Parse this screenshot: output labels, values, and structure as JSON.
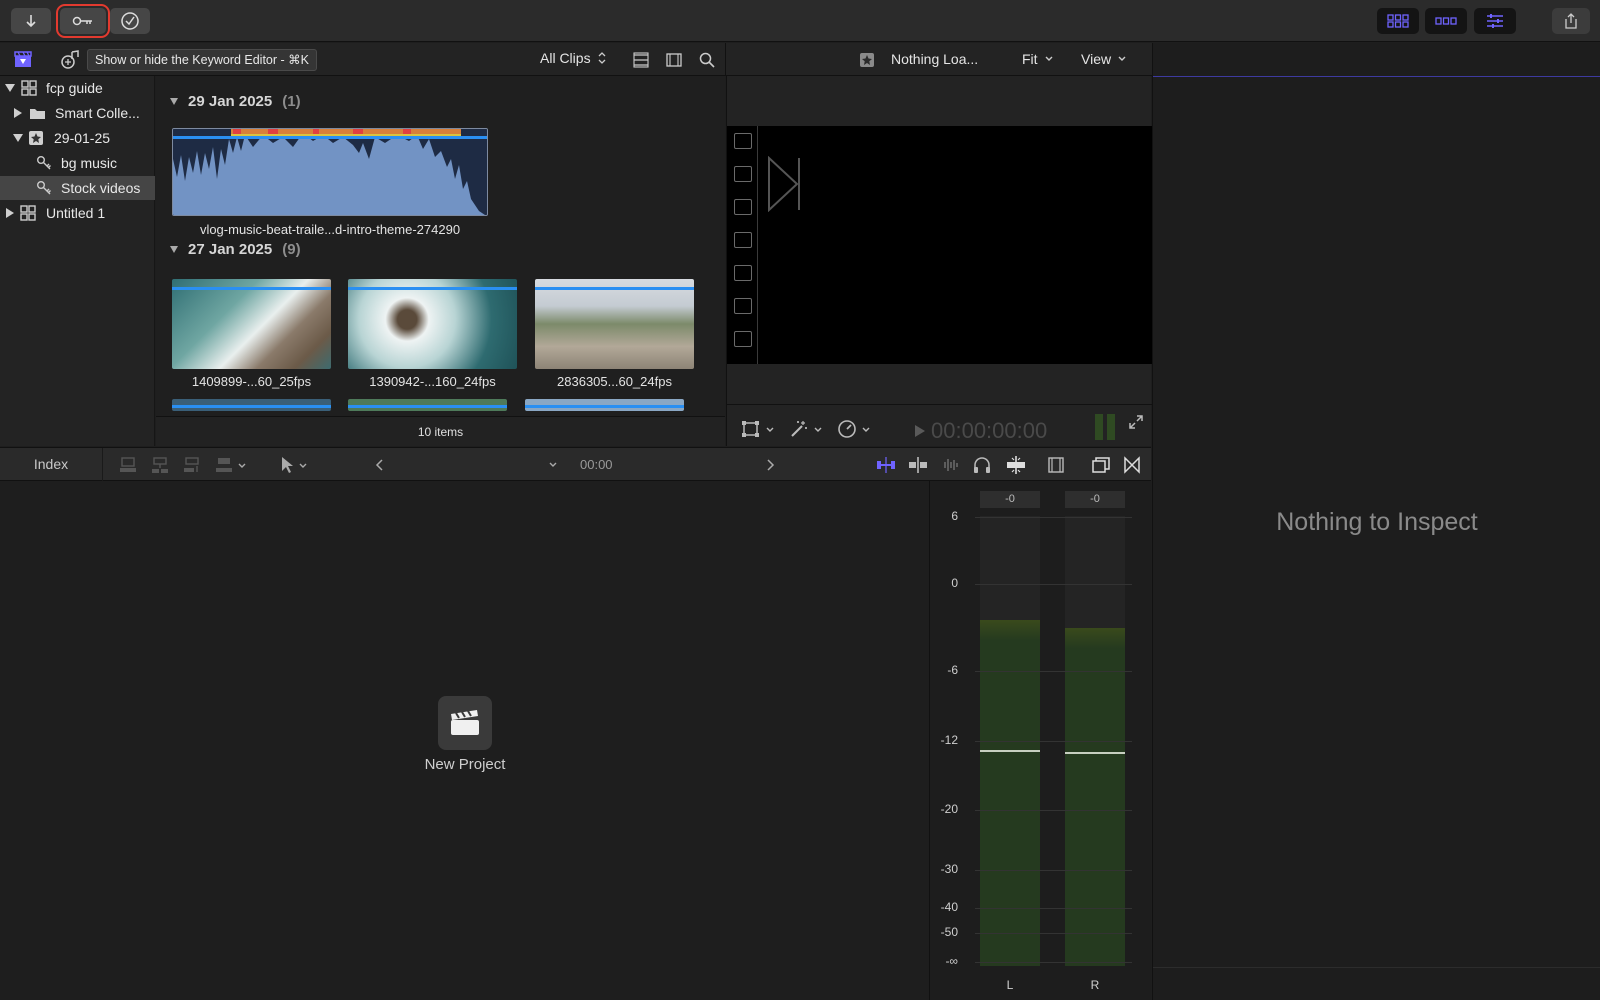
{
  "toolbar": {
    "buttons": [
      {
        "icon": "import-arrow-icon"
      },
      {
        "icon": "keyword-key-icon",
        "highlighted": true
      },
      {
        "icon": "checkmark-circle-icon"
      }
    ],
    "right_buttons": [
      {
        "icon": "browser-grid-icon"
      },
      {
        "icon": "timeline-icon"
      },
      {
        "icon": "inspector-sliders-icon"
      },
      {
        "icon": "share-icon"
      }
    ]
  },
  "tooltip": "Show or hide the Keyword Editor - ⌘K",
  "browser_header": {
    "filter": "All Clips",
    "viewer_title": "Nothing Loa...",
    "fit": "Fit",
    "view": "View"
  },
  "sidebar": {
    "items": [
      {
        "label": "fcp guide",
        "icon": "library-icon",
        "expanded": true
      },
      {
        "label": "Smart Colle...",
        "icon": "folder-icon",
        "expanded": false
      },
      {
        "label": "29-01-25",
        "icon": "event-star-icon",
        "expanded": true
      },
      {
        "label": "bg music",
        "icon": "keyword-icon"
      },
      {
        "label": "Stock videos",
        "icon": "keyword-icon",
        "selected": true
      },
      {
        "label": "Untitled 1",
        "icon": "library-icon",
        "expanded": false
      }
    ]
  },
  "browser": {
    "groups": [
      {
        "date": "29 Jan 2025",
        "count": "(1)"
      },
      {
        "date": "27 Jan 2025",
        "count": "(9)"
      }
    ],
    "clips": [
      {
        "label": "vlog-music-beat-traile...d-intro-theme-274290",
        "type": "audio"
      },
      {
        "label": "1409899-...60_25fps",
        "type": "video"
      },
      {
        "label": "1390942-...160_24fps",
        "type": "video"
      },
      {
        "label": "2836305...60_24fps",
        "type": "video"
      }
    ],
    "items_count": "10 items"
  },
  "viewer": {
    "timecode": "00:00:00:00"
  },
  "inspector": {
    "message": "Nothing to Inspect"
  },
  "timeline_bar": {
    "index_label": "Index",
    "time": "00:00"
  },
  "timeline": {
    "new_project_label": "New Project"
  },
  "meters": {
    "peaks": [
      "-0",
      "-0"
    ],
    "scale": [
      "6",
      "0",
      "-6",
      "-12",
      "-20",
      "-30",
      "-40",
      "-50",
      "-∞"
    ],
    "channels": [
      "L",
      "R"
    ],
    "levels_db": [
      -2.5,
      -3
    ],
    "peak_hold_db": [
      -13,
      -13.3
    ]
  },
  "colors": {
    "accent_blue": "#2a8ff2",
    "highlight_red": "#e33a2f",
    "meter_green": "#253a1f",
    "purple_icons": "#6f63ff"
  }
}
